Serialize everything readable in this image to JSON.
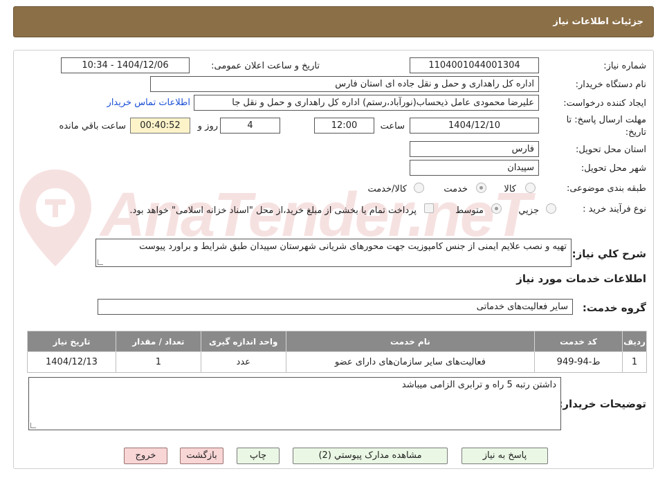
{
  "header": {
    "title": "جزئیات اطلاعات نیاز"
  },
  "fields": {
    "need_number_label": "شماره نیاز:",
    "need_number": "1104001044001304",
    "announce_label": "تاریخ و ساعت اعلان عمومی:",
    "announce_value": "1404/12/06 - 10:34",
    "buyer_org_label": "نام دستگاه خریدار:",
    "buyer_org": "اداره کل راهداری و حمل و نقل جاده ای استان فارس",
    "requester_label": "ایجاد کننده درخواست:",
    "requester": "علیرضا محمودی عامل ذیحساب(نورآباد،رستم) اداره کل راهداری و حمل و نقل جا",
    "contact_link": "اطلاعات تماس خریدار",
    "deadline_label_1": "مهلت ارسال پاسخ: تا",
    "deadline_label_2": "تاریخ:",
    "deadline_date": "1404/12/10",
    "time_label": "ساعت",
    "deadline_time": "12:00",
    "days": "4",
    "days_label": "روز و",
    "remaining_timer": "00:40:52",
    "remaining_label": "ساعت باقي مانده",
    "delivery_province_label": "استان محل تحویل:",
    "delivery_province": "فارس",
    "delivery_city_label": "شهر محل تحویل:",
    "delivery_city": "سپیدان",
    "category_label": "طبقه بندی موضوعی:",
    "category_options": [
      "کالا",
      "خدمت",
      "کالا/خدمت"
    ],
    "process_label": "نوع فرآیند خرید :",
    "process_options": [
      "جزيي",
      "متوسط"
    ],
    "payment_note": "پرداخت تمام یا بخشی از مبلغ خرید،از محل \"اسناد خزانه اسلامی\" خواهد بود.",
    "summary_label": "شرح کلي نياز:",
    "summary": "تهیه و نصب علایم ایمنی از جنس کامپوزیت جهت محورهای شریانی شهرستان سپیدان طبق شرایط و براورد پیوست"
  },
  "services_section": {
    "title": "اطلاعات خدمات مورد نیاز",
    "group_label": "گروه خدمت:",
    "group_value": "سایر فعالیت‌های خدماتی",
    "table": {
      "headers": [
        "ردیف",
        "کد خدمت",
        "نام خدمت",
        "واحد اندازه گیری",
        "تعداد / مقدار",
        "تاریخ نیاز"
      ],
      "rows": [
        [
          "1",
          "ط-94-949",
          "فعالیت‌های سایر سازمان‌های دارای عضو",
          "عدد",
          "1",
          "1404/12/13"
        ]
      ]
    }
  },
  "buyer_notes": {
    "label": "توضیحات خریدار:",
    "text": "داشتن رتبه 5 راه و ترابری الزامی میباشد"
  },
  "buttons": {
    "reply": "پاسخ به نیاز",
    "attachments": "مشاهده مدارک پیوستي (2)",
    "print": "چاپ",
    "back": "بازگشت",
    "exit": "خروج"
  },
  "watermark": {
    "text": "AnaTender.neT"
  },
  "colors": {
    "header_bg": "#8b6f47",
    "table_header_bg": "#8a8a8a",
    "timer_bg": "#fcf3c9",
    "button_green": "#eaf7e4",
    "button_pink": "#f9d6d6",
    "link": "#1a4fd6"
  }
}
